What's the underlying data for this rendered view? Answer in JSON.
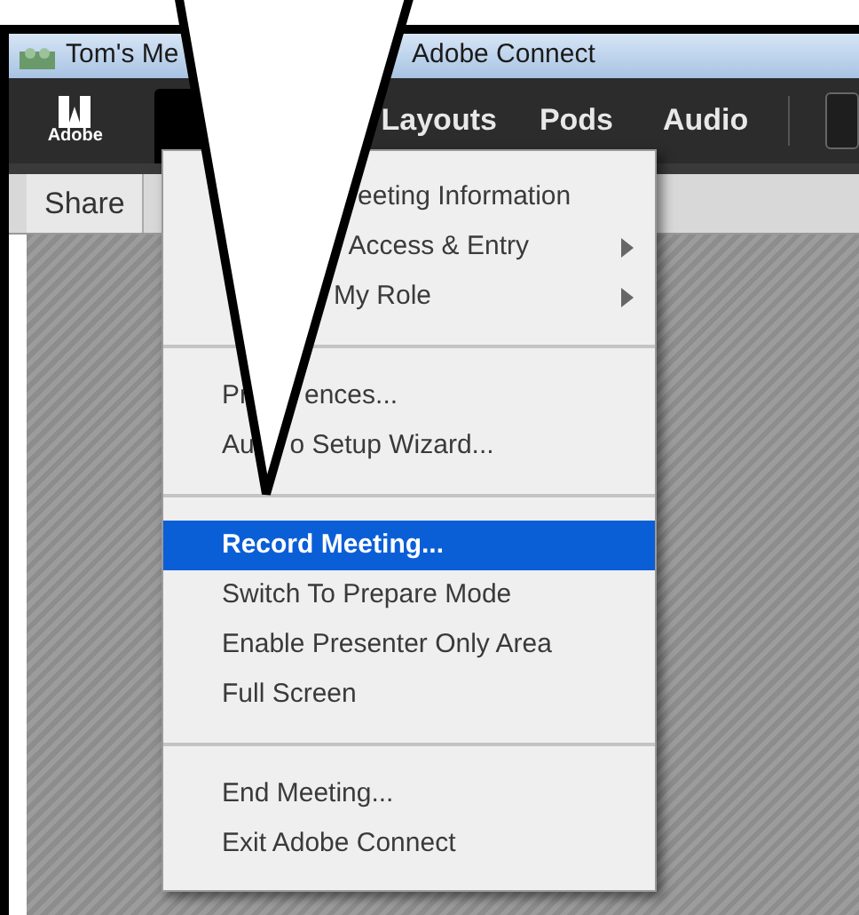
{
  "window": {
    "title_parts": [
      "Tom's Me",
      "Adobe Connect"
    ]
  },
  "toolbar": {
    "logo": "Adobe",
    "menus": [
      {
        "label": "Layouts"
      },
      {
        "label": "Pods"
      },
      {
        "label": "Audio"
      }
    ]
  },
  "pod": {
    "tab": "Share"
  },
  "menu": {
    "items": [
      {
        "kind": "item",
        "parts": [
          "eeting Information"
        ],
        "submenu": false,
        "selected": false
      },
      {
        "kind": "item",
        "parts": [
          "Access & Entry"
        ],
        "submenu": true,
        "selected": false
      },
      {
        "kind": "item",
        "parts": [
          "My Role"
        ],
        "submenu": true,
        "selected": false
      },
      {
        "kind": "separator"
      },
      {
        "kind": "item",
        "parts": [
          "Pr",
          "ences..."
        ],
        "submenu": false,
        "selected": false
      },
      {
        "kind": "item",
        "parts": [
          "Au",
          "o Setup Wizard..."
        ],
        "submenu": false,
        "selected": false
      },
      {
        "kind": "separator"
      },
      {
        "kind": "item",
        "parts": [
          "Record Meeting..."
        ],
        "submenu": false,
        "selected": true
      },
      {
        "kind": "item",
        "parts": [
          "Switch To Prepare Mode"
        ],
        "submenu": false,
        "selected": false
      },
      {
        "kind": "item",
        "parts": [
          "Enable Presenter Only Area"
        ],
        "submenu": false,
        "selected": false
      },
      {
        "kind": "item",
        "parts": [
          "Full Screen"
        ],
        "submenu": false,
        "selected": false
      },
      {
        "kind": "separator"
      },
      {
        "kind": "item",
        "parts": [
          "End Meeting..."
        ],
        "submenu": false,
        "selected": false
      },
      {
        "kind": "item",
        "parts": [
          "Exit Adobe Connect"
        ],
        "submenu": false,
        "selected": false
      }
    ]
  }
}
